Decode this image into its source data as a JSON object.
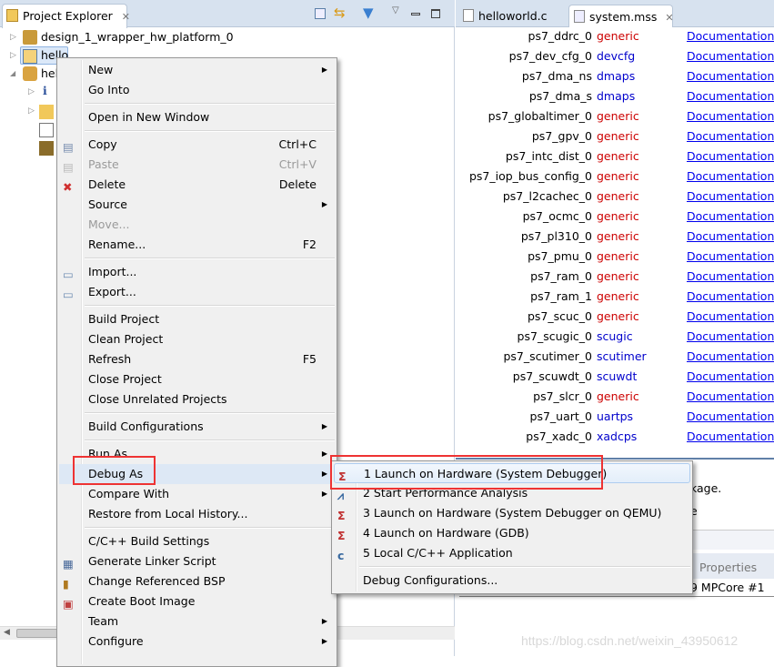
{
  "left_panel": {
    "tab_title": "Project Explorer",
    "tree": [
      {
        "label": "design_1_wrapper_hw_platform_0",
        "icon": "hw-platform-icon"
      },
      {
        "label": "hello",
        "icon": "project-folder-icon",
        "selected": true
      },
      {
        "label": "hel",
        "icon": "bsp-project-icon",
        "expanded": true
      }
    ]
  },
  "editor": {
    "tabs": [
      {
        "label": "helloworld.c"
      },
      {
        "label": "system.mss",
        "active": true
      }
    ],
    "rows": [
      {
        "name": "ps7_ddrc_0",
        "driver": "generic",
        "doc": "Documentation"
      },
      {
        "name": "ps7_dev_cfg_0",
        "driver": "devcfg",
        "doc": "Documentation"
      },
      {
        "name": "ps7_dma_ns",
        "driver": "dmaps",
        "doc": "Documentation"
      },
      {
        "name": "ps7_dma_s",
        "driver": "dmaps",
        "doc": "Documentation"
      },
      {
        "name": "ps7_globaltimer_0",
        "driver": "generic",
        "doc": "Documentation"
      },
      {
        "name": "ps7_gpv_0",
        "driver": "generic",
        "doc": "Documentation"
      },
      {
        "name": "ps7_intc_dist_0",
        "driver": "generic",
        "doc": "Documentation"
      },
      {
        "name": "ps7_iop_bus_config_0",
        "driver": "generic",
        "doc": "Documentation"
      },
      {
        "name": "ps7_l2cachec_0",
        "driver": "generic",
        "doc": "Documentation"
      },
      {
        "name": "ps7_ocmc_0",
        "driver": "generic",
        "doc": "Documentation"
      },
      {
        "name": "ps7_pl310_0",
        "driver": "generic",
        "doc": "Documentation"
      },
      {
        "name": "ps7_pmu_0",
        "driver": "generic",
        "doc": "Documentation"
      },
      {
        "name": "ps7_ram_0",
        "driver": "generic",
        "doc": "Documentation"
      },
      {
        "name": "ps7_ram_1",
        "driver": "generic",
        "doc": "Documentation"
      },
      {
        "name": "ps7_scuc_0",
        "driver": "generic",
        "doc": "Documentation"
      },
      {
        "name": "ps7_scugic_0",
        "driver": "scugic",
        "doc": "Documentation"
      },
      {
        "name": "ps7_scutimer_0",
        "driver": "scutimer",
        "doc": "Documentation"
      },
      {
        "name": "ps7_scuwdt_0",
        "driver": "scuwdt",
        "doc": "Documentation"
      },
      {
        "name": "ps7_slcr_0",
        "driver": "generic",
        "doc": "Documentation"
      },
      {
        "name": "ps7_uart_0",
        "driver": "uartps",
        "doc": "Documentation"
      },
      {
        "name": "ps7_xadc_0",
        "driver": "xadcps",
        "doc": "Documentation"
      }
    ],
    "partial_text_1": "kage.",
    "partial_text_2": "e",
    "properties_tab": "Properties",
    "properties_value": "9 MPCore #1",
    "watermark": "https://blog.csdn.net/weixin_43950612"
  },
  "context_menu": {
    "items": [
      {
        "label": "New",
        "submenu": true
      },
      {
        "label": "Go Into"
      },
      {
        "label": "Open in New Window"
      },
      {
        "label": "Copy",
        "shortcut": "Ctrl+C"
      },
      {
        "label": "Paste",
        "shortcut": "Ctrl+V",
        "disabled": true
      },
      {
        "label": "Delete",
        "shortcut": "Delete"
      },
      {
        "label": "Source",
        "submenu": true
      },
      {
        "label": "Move...",
        "disabled": true
      },
      {
        "label": "Rename...",
        "shortcut": "F2"
      },
      {
        "label": "Import..."
      },
      {
        "label": "Export..."
      },
      {
        "label": "Build Project"
      },
      {
        "label": "Clean Project"
      },
      {
        "label": "Refresh",
        "shortcut": "F5"
      },
      {
        "label": "Close Project"
      },
      {
        "label": "Close Unrelated Projects"
      },
      {
        "label": "Build Configurations",
        "submenu": true
      },
      {
        "label": "Run As",
        "submenu": true
      },
      {
        "label": "Debug As",
        "submenu": true,
        "highlighted": true
      },
      {
        "label": "Compare With",
        "submenu": true
      },
      {
        "label": "Restore from Local History..."
      },
      {
        "label": "C/C++ Build Settings"
      },
      {
        "label": "Generate Linker Script"
      },
      {
        "label": "Change Referenced BSP"
      },
      {
        "label": "Create Boot Image"
      },
      {
        "label": "Team",
        "submenu": true
      },
      {
        "label": "Configure",
        "submenu": true
      }
    ]
  },
  "debug_submenu": {
    "items": [
      {
        "label": "1 Launch on Hardware (System Debugger)",
        "icon": "tcf-icon",
        "highlighted": true
      },
      {
        "label": "2 Start Performance Analysis",
        "icon": "performance-icon"
      },
      {
        "label": "3 Launch on Hardware (System Debugger on QEMU)",
        "icon": "tcf-icon"
      },
      {
        "label": "4 Launch on Hardware (GDB)",
        "icon": "gdb-icon"
      },
      {
        "label": "5 Local C/C++ Application",
        "icon": "c-app-icon"
      },
      {
        "label": "Debug Configurations..."
      }
    ]
  },
  "colors": {
    "highlight_box": "#ee3333",
    "link": "#0000ee",
    "driver": "#cc0000",
    "driver_alt": "#0000cc"
  }
}
